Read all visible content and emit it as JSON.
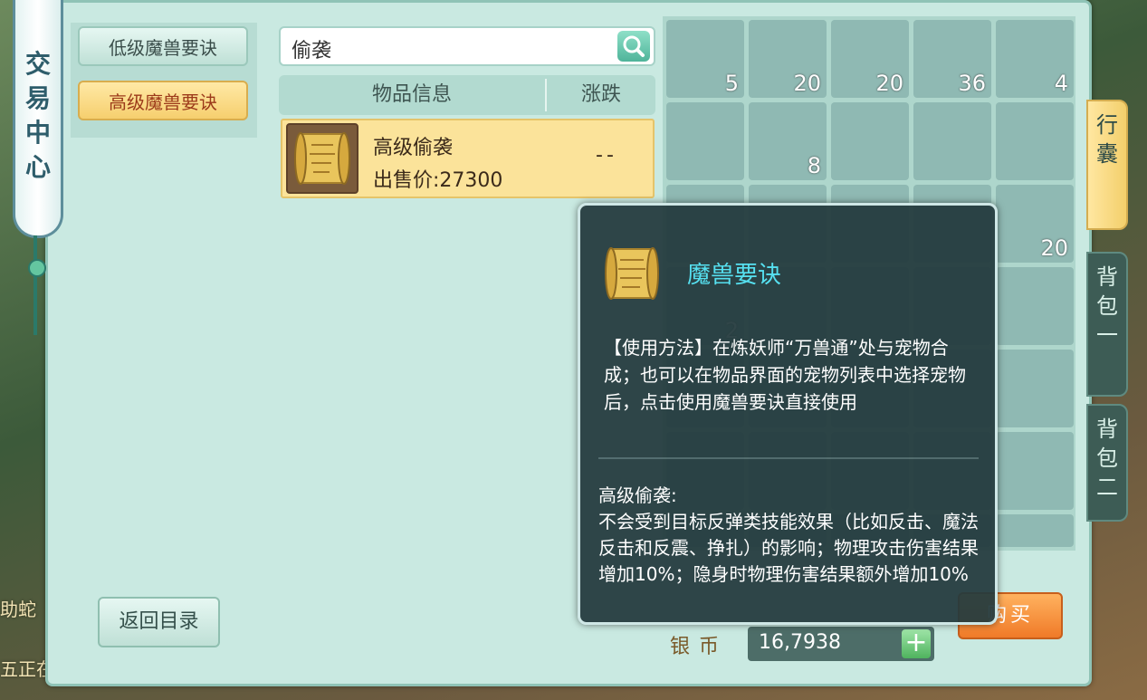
{
  "window": {
    "title": "交易中心"
  },
  "sidebar": {
    "categories": [
      {
        "label": "低级魔兽要诀",
        "active": false
      },
      {
        "label": "高级魔兽要诀",
        "active": true
      }
    ]
  },
  "search": {
    "value": "偷袭"
  },
  "list": {
    "headers": [
      "物品信息",
      "涨跌"
    ],
    "items": [
      {
        "name": "高级偷袭",
        "price": "出售价:27300",
        "trend": "--"
      }
    ]
  },
  "inventory": {
    "counts": [
      "5",
      "20",
      "20",
      "36",
      "4",
      "",
      "8",
      "",
      "",
      "",
      "",
      "",
      "",
      "",
      "20",
      "2"
    ]
  },
  "side_tabs": [
    "行囊",
    "背包一",
    "背包二"
  ],
  "footer": {
    "back_label": "返回目录",
    "silver_label": "银币",
    "silver_value": "16,7938",
    "buy_label": "购买"
  },
  "tooltip": {
    "title": "魔兽要诀",
    "description": "【使用方法】在炼妖师“万兽通”处与宠物合成；也可以在物品界面的宠物列表中选择宠物后，点击使用魔兽要诀直接使用",
    "skill_name": "高级偷袭:",
    "skill_text": "不会受到目标反弹类技能效果（比如反击、魔法反击和反震、挣扎）的影响；物理攻击伤害结果增加10%；隐身时物理伤害结果额外增加10%"
  },
  "background": {
    "left_text": [
      "助蛇",
      "五正在"
    ]
  },
  "colors": {
    "accent_gold": "#f6cf6e",
    "tooltip_title": "#56e0f0",
    "buy": "#f07a28"
  }
}
